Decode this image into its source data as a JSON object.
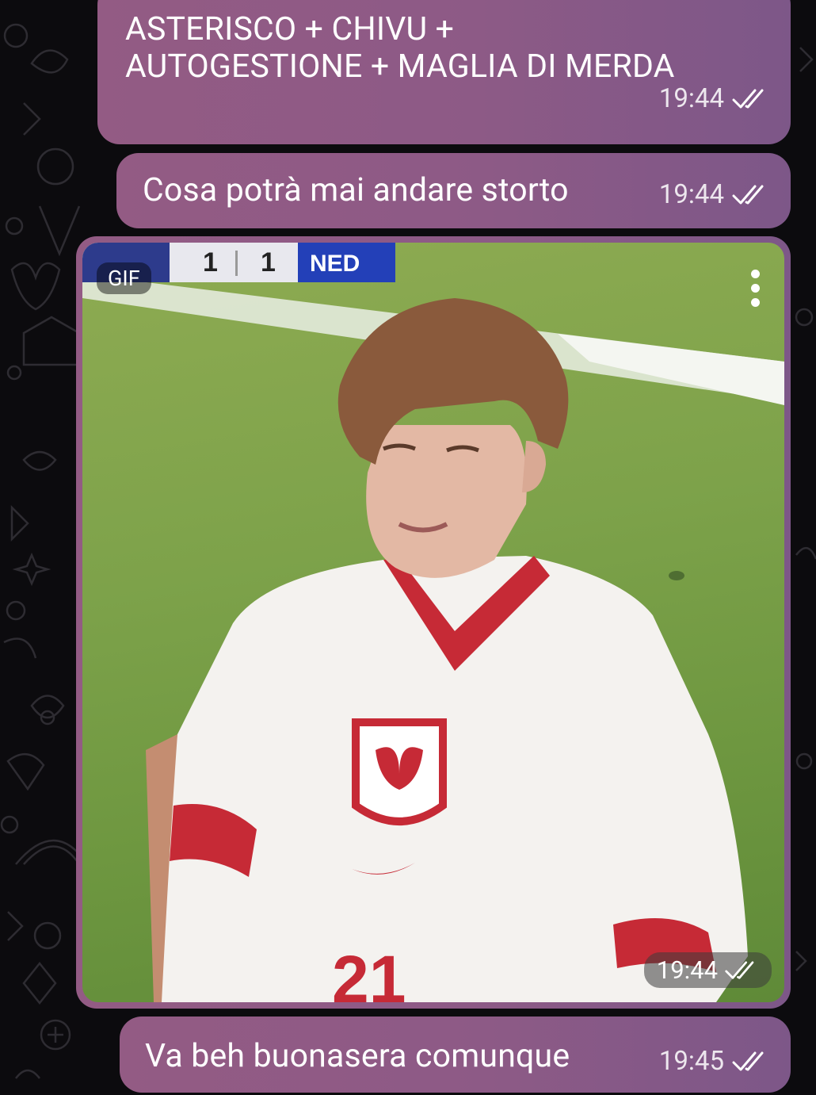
{
  "messages": [
    {
      "text": "ASTERISCO + CHIVU +\nAUTOGESTIONE + MAGLIA DI MERDA",
      "time": "19:44",
      "status_icon": "double-check-icon"
    },
    {
      "text": "Cosa potrà mai andare storto",
      "time": "19:44",
      "status_icon": "double-check-icon"
    },
    {
      "type": "gif",
      "badge": "GIF",
      "time": "19:44",
      "status_icon": "double-check-icon",
      "scoreboard": {
        "home_score": "1",
        "away_score": "1",
        "away_team": "NED"
      },
      "shirt_number": "21"
    },
    {
      "text": "Va beh buonasera comunque",
      "time": "19:45",
      "status_icon": "double-check-icon"
    }
  ],
  "colors": {
    "bubble": "#8d5a86",
    "background": "#0c0b0e",
    "shirt_red": "#c62a36"
  }
}
